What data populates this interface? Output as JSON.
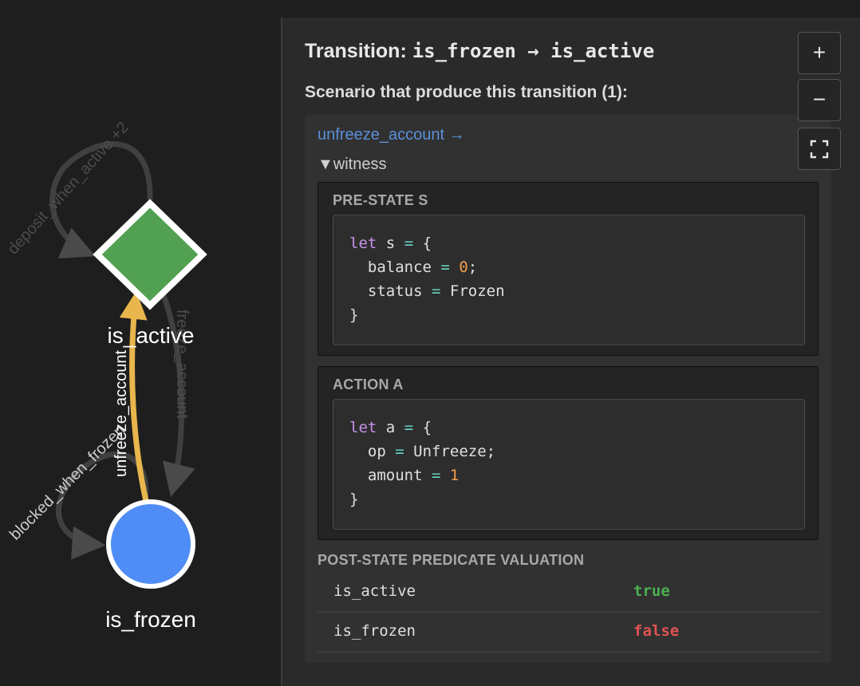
{
  "graph": {
    "nodes": [
      {
        "id": "is_active",
        "label": "is_active",
        "shape": "diamond",
        "color": "#52a052"
      },
      {
        "id": "is_frozen",
        "label": "is_frozen",
        "shape": "circle",
        "color": "#4f8cf6"
      }
    ],
    "edges": [
      {
        "from": "is_active",
        "to": "is_active",
        "label": "deposit_when_active +2"
      },
      {
        "from": "is_active",
        "to": "is_frozen",
        "label": "freeze_account"
      },
      {
        "from": "is_frozen",
        "to": "is_frozen",
        "label": "blocked_when_frozen"
      },
      {
        "from": "is_frozen",
        "to": "is_active",
        "label": "unfreeze_account",
        "highlighted": true
      }
    ],
    "highlight_color": "#e8b64c"
  },
  "panel": {
    "title_prefix": "Transition: ",
    "title_transition": "is_frozen → is_active",
    "subtitle": "Scenario that produce this transition (1):",
    "scenario": {
      "link_label": "unfreeze_account →",
      "witness_label": "▼witness",
      "pre_state": {
        "label": "PRE-STATE S",
        "code": {
          "kw": "let",
          "var": "s",
          "eq": "=",
          "open": "{",
          "close": "}",
          "f1_name": "balance",
          "f1_val": "0",
          "f2_name": "status",
          "f2_val": "Frozen"
        }
      },
      "action": {
        "label": "ACTION A",
        "code": {
          "kw": "let",
          "var": "a",
          "eq": "=",
          "open": "{",
          "close": "}",
          "f1_name": "op",
          "f1_val": "Unfreeze",
          "f2_name": "amount",
          "f2_val": "1"
        }
      },
      "post_state": {
        "label": "POST-STATE PREDICATE VALUATION",
        "rows": [
          {
            "name": "is_active",
            "value": "true"
          },
          {
            "name": "is_frozen",
            "value": "false"
          }
        ]
      }
    }
  },
  "zoom": {
    "zoom_in": "+",
    "zoom_out": "−",
    "fit": "fit-screen-icon"
  }
}
